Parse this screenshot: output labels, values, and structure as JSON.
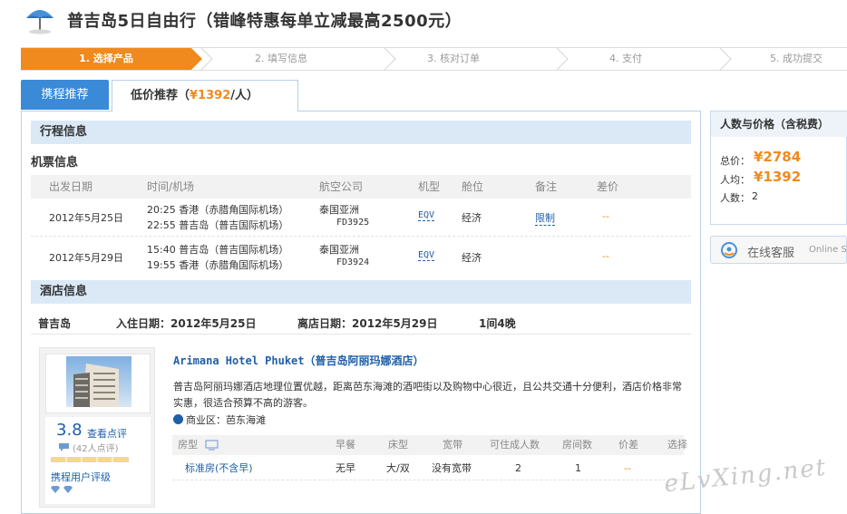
{
  "header": {
    "title": "普吉岛5日自由行（错峰特惠每单立减最高2500元）",
    "icon": "umbrella-icon"
  },
  "steps": [
    {
      "label": "1. 选择产品",
      "active": true
    },
    {
      "label": "2. 填写信息",
      "active": false
    },
    {
      "label": "3. 核对订单",
      "active": false
    },
    {
      "label": "4. 支付",
      "active": false
    },
    {
      "label": "5. 成功提交",
      "active": false
    }
  ],
  "tabs": {
    "tab1": "携程推荐",
    "tab2_prefix": "低价推荐（",
    "tab2_price": "¥1392",
    "tab2_suffix": "/人）"
  },
  "itinerary": {
    "section_title": "行程信息",
    "flight_title": "机票信息",
    "columns": [
      "出发日期",
      "时间/机场",
      "航空公司",
      "机型",
      "舱位",
      "备注",
      "差价"
    ],
    "flights": [
      {
        "date": "2012年5月25日",
        "seg1": "20:25 香港（赤腊角国际机场）",
        "seg2": "22:55 普吉岛（普吉国际机场）",
        "airline": "泰国亚洲",
        "flight_no": "FD3925",
        "aircraft": "EQV",
        "cabin": "经济",
        "note": "限制",
        "diff": "--"
      },
      {
        "date": "2012年5月29日",
        "seg1": "15:40 普吉岛（普吉国际机场）",
        "seg2": "19:55 香港（赤腊角国际机场）",
        "airline": "泰国亚洲",
        "flight_no": "FD3924",
        "aircraft": "EQV",
        "cabin": "经济",
        "note": "",
        "diff": "--"
      }
    ]
  },
  "hotel": {
    "section_title": "酒店信息",
    "city": "普吉岛",
    "checkin": "入住日期：2012年5月25日",
    "checkout": "离店日期：2012年5月29日",
    "nights": "1间4晚",
    "name": "Arimana Hotel Phuket（普吉岛阿丽玛娜酒店）",
    "desc": "普吉岛阿丽玛娜酒店地理位置优越，距离芭东海滩的酒吧街以及购物中心很近，且公共交通十分便利，酒店价格非常实惠，很适合预算不高的游客。",
    "area": "商业区：芭东海滩",
    "score": "3.8",
    "see_comments": "查看点评",
    "comment_count": "(42人点评)",
    "rating_label": "携程用户评级",
    "room_columns": [
      "房型",
      "早餐",
      "床型",
      "宽带",
      "可住成人数",
      "房间数",
      "价差",
      "选择"
    ],
    "room": {
      "type": "标准房(不含早)",
      "breakfast": "无早",
      "bed": "大/双",
      "broadband": "没有宽带",
      "adults": "2",
      "rooms": "1",
      "diff": "--"
    }
  },
  "price_panel": {
    "title": "人数与价格（含税费）",
    "total_label": "总价：",
    "total": "¥2784",
    "per_label": "人均：",
    "per": "¥1392",
    "count_label": "人数：",
    "count": "2"
  },
  "service": {
    "label": "在线客服",
    "sub": "Online Se"
  },
  "watermark": "eLvXing.net",
  "colors": {
    "accent": "#f08a1e",
    "link": "#1f5fa8",
    "section_bg": "#dbe9f7",
    "tab_active": "#3a8ad8"
  }
}
